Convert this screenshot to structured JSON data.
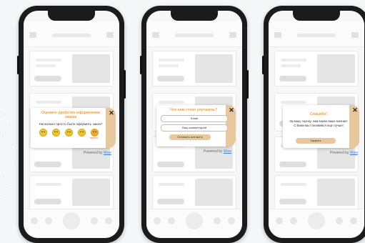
{
  "phone1": {
    "popup_title": "Оцените удобство оформления заказа",
    "question": "Насколько просто было оформить заказ?",
    "emojis": [
      "face-1-icon",
      "face-2-icon",
      "face-3-icon",
      "face-4-icon",
      "heart-eyes-icon"
    ],
    "emoji_label": "просто",
    "close": "✕"
  },
  "phone2": {
    "popup_title": "Что нам стоит улучшить?",
    "email_placeholder": "Email",
    "comment_placeholder": "Ваш комментарий",
    "submit_label": "Оставить контакты",
    "close": "✕"
  },
  "phone3": {
    "popup_title": "Спасибо!",
    "message_line1": "За вашу оценку, нам важно ваше мнение!",
    "message_line2": "С Вами мы становимся еще лучше!",
    "close_button_label": "Закрыть",
    "close": "✕"
  },
  "powered_by": {
    "prefix": "Powered by",
    "brand": "Wow"
  },
  "colors": {
    "accent": "#e7c89c",
    "title": "#e5a24a",
    "emoji": "#f2c329"
  }
}
